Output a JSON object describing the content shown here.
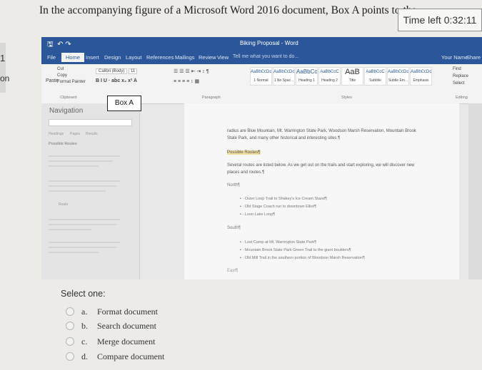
{
  "question": {
    "text": "In the accompanying figure of a Microsoft Word 2016 document, Box A points to the",
    "timer_label": "Time left",
    "time_left": "0:32:11",
    "select_one": "Select one:",
    "options": [
      {
        "letter": "a.",
        "text": "Format document"
      },
      {
        "letter": "b.",
        "text": "Search document"
      },
      {
        "letter": "c.",
        "text": "Merge document"
      },
      {
        "letter": "d.",
        "text": "Compare document"
      }
    ]
  },
  "sidebar": {
    "number": "1",
    "label": "on"
  },
  "word": {
    "doc_title": "Biking Proposal - Word",
    "tabs": [
      "File",
      "Home",
      "Insert",
      "Design",
      "Layout",
      "References",
      "Mailings",
      "Review",
      "View"
    ],
    "tell_me": "Tell me what you want to do...",
    "user": "Your Name",
    "share": "Share",
    "clipboard": {
      "cut": "Cut",
      "copy": "Copy",
      "format_painter": "Format Painter",
      "paste": "Paste",
      "label": "Clipboard"
    },
    "font": {
      "name": "Calibri (Body)",
      "size": "11"
    },
    "styles": [
      {
        "preview": "AaBbCcDc",
        "name": "1 Normal"
      },
      {
        "preview": "AaBbCcDc",
        "name": "1 No Spac..."
      },
      {
        "preview": "AaBbCc",
        "name": "Heading 1"
      },
      {
        "preview": "AaBbCcC",
        "name": "Heading 2"
      },
      {
        "preview": "AaB",
        "name": "Title"
      },
      {
        "preview": "AaBbCcC",
        "name": "Subtitle"
      },
      {
        "preview": "AaBbCcDc",
        "name": "Subtle Em..."
      },
      {
        "preview": "AaBbCcDc",
        "name": "Emphasis"
      }
    ],
    "group_labels": {
      "paragraph": "Paragraph",
      "styles": "Styles",
      "editing": "Editing"
    },
    "editing": {
      "find": "Find",
      "replace": "Replace",
      "select": "Select"
    },
    "box_a": "Box A",
    "navigation": {
      "title": "Navigation",
      "tabs": [
        "Headings",
        "Pages",
        "Results"
      ],
      "heading": "Possible Routes",
      "subitem": "Route"
    },
    "document": {
      "line1": "radius are Blue Mountain, Mt. Warrington State Park, Woodson Marsh Reservation, Mountain Brook",
      "line2": "State Park, and many other historical and interesting sites.¶",
      "possible_routes": "Possible Routes¶",
      "line3": "Several routes are listed below. As we get out on the trails and start exploring, we will discover new",
      "line4": "places and routes.¶",
      "north": "North¶",
      "north_items": [
        "Outer Loop Trail to Shakey's Ice Cream Stand¶",
        "Old Stage Coach run to downtown Elliot¶",
        "Loon Lake Loop¶"
      ],
      "south": "South¶",
      "south_items": [
        "Lost Camp at Mt. Warrington State Park¶",
        "Mountain Brook State Park Green Trail to the giant boulders¶",
        "Old Mill Trail in the southern portion of Woodson Marsh Reservation¶"
      ],
      "east": "East¶"
    }
  }
}
